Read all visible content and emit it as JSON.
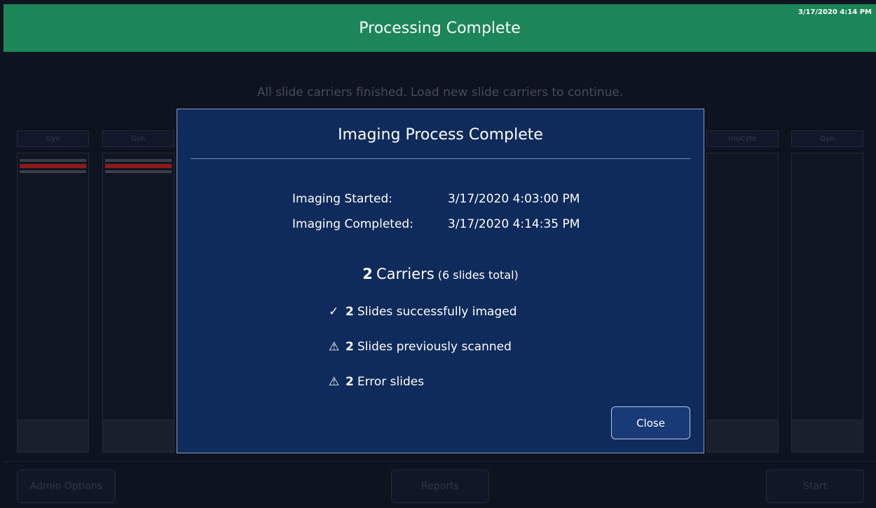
{
  "header": {
    "title": "Processing Complete",
    "timestamp": "3/17/2020 4:14 PM"
  },
  "background": {
    "message": "All slide carriers finished. Load new slide carriers to continue.",
    "carriers": [
      {
        "label": "Gyn"
      },
      {
        "label": "Gyn"
      },
      {
        "label": "UroCyte"
      },
      {
        "label": "Gyn"
      }
    ],
    "buttons": {
      "admin": "Admin Options",
      "reports": "Reports",
      "start": "Start"
    }
  },
  "modal": {
    "title": "Imaging Process Complete",
    "started_label": "Imaging Started:",
    "started_value": "3/17/2020 4:03:00 PM",
    "completed_label": "Imaging Completed:",
    "completed_value": "3/17/2020 4:14:35 PM",
    "carriers_count": "2",
    "carriers_word": "Carriers",
    "slides_total": "(6 slides total)",
    "stats": [
      {
        "icon": "check-icon",
        "glyph": "✓",
        "count": "2",
        "text": "Slides successfully imaged"
      },
      {
        "icon": "warning-icon",
        "glyph": "⚠",
        "count": "2",
        "text": "Slides previously scanned"
      },
      {
        "icon": "warning-icon",
        "glyph": "⚠",
        "count": "2",
        "text": "Error slides"
      }
    ],
    "close_label": "Close"
  },
  "colors": {
    "header_bg": "#1d8658",
    "modal_bg": "#0f2b5c",
    "page_bg": "#0e1320",
    "error_strip": "#8b1a1a"
  }
}
